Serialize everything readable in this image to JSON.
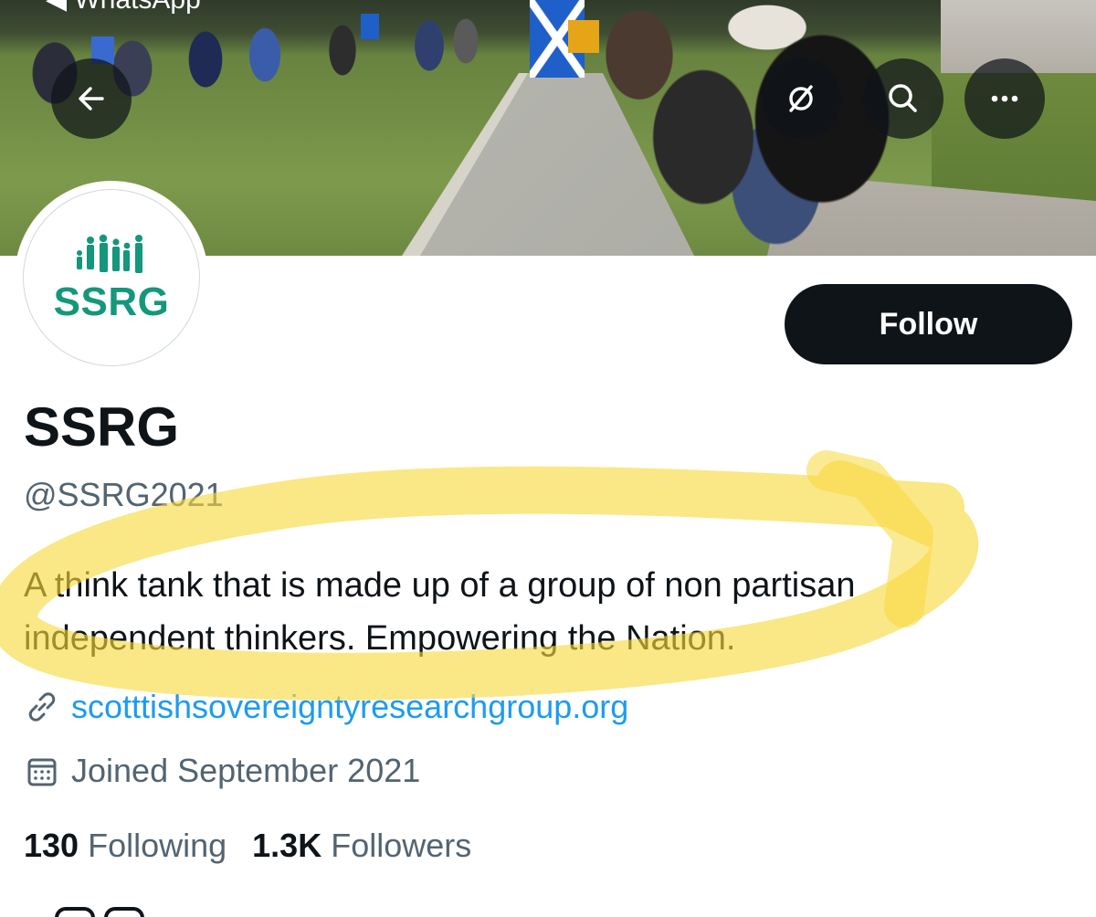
{
  "status_bar": {
    "back_app_label": "◀ WhatsApp"
  },
  "banner": {
    "description": "crowd with flags on a grassy path"
  },
  "toolbar": {
    "back_icon": "arrow-left-icon",
    "grok_icon": "grok-slash-icon",
    "search_icon": "search-icon",
    "more_icon": "more-horizontal-icon"
  },
  "avatar": {
    "text": "SSRG",
    "color": "#14977b"
  },
  "follow_button": {
    "label": "Follow"
  },
  "profile": {
    "display_name": "SSRG",
    "handle": "@SSRG2021",
    "bio": "A think tank that is made up of a group of non partisan independent thinkers. Empowering the Nation.",
    "website": "scotttishsovereigntyresearchgroup.org",
    "joined": "Joined September 2021"
  },
  "stats": {
    "following": {
      "count": "130",
      "label": "Following"
    },
    "followers": {
      "count": "1.3K",
      "label": "Followers"
    }
  },
  "colors": {
    "text_primary": "#0f1419",
    "text_secondary": "#536471",
    "link": "#1d9bf0",
    "highlighter": "#f7d93c"
  }
}
